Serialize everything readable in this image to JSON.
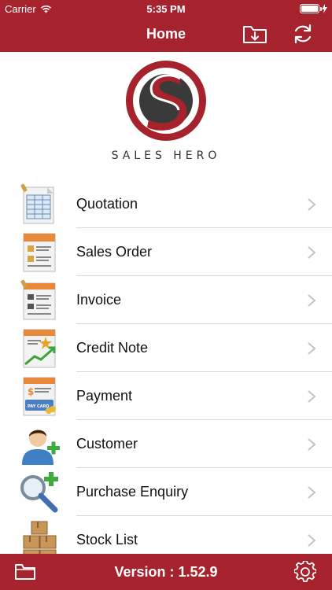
{
  "status": {
    "carrier": "Carrier",
    "time": "5:35 PM",
    "battery_level": 1.0
  },
  "nav": {
    "title": "Home"
  },
  "logo": {
    "text": "SALES HERO"
  },
  "menu": [
    {
      "label": "Quotation",
      "icon": "quotation-icon"
    },
    {
      "label": "Sales Order",
      "icon": "sales-order-icon"
    },
    {
      "label": "Invoice",
      "icon": "invoice-icon"
    },
    {
      "label": "Credit Note",
      "icon": "credit-note-icon"
    },
    {
      "label": "Payment",
      "icon": "payment-icon"
    },
    {
      "label": "Customer",
      "icon": "customer-icon"
    },
    {
      "label": "Purchase Enquiry",
      "icon": "purchase-enquiry-icon"
    },
    {
      "label": "Stock List",
      "icon": "stock-list-icon"
    }
  ],
  "payment_card_text": "PAY CARD",
  "footer": {
    "version": "Version : 1.52.9"
  },
  "colors": {
    "brand": "#a6232e",
    "separator": "#d9d9d9"
  }
}
